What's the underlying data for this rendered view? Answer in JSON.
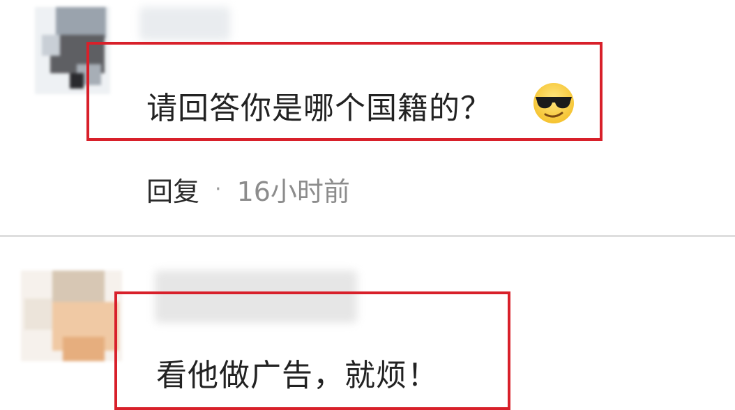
{
  "comments": [
    {
      "text": "请回答你是哪个国籍的？",
      "emoji": "sunglasses-face-emoji",
      "reply_label": "回复",
      "separator": "·",
      "time": "16小时前"
    },
    {
      "text": "看他做广告，就烦！"
    }
  ],
  "colors": {
    "highlight_border": "#d8202a",
    "divider": "#dedede",
    "text": "#222222",
    "meta": "#8c8c8c"
  }
}
